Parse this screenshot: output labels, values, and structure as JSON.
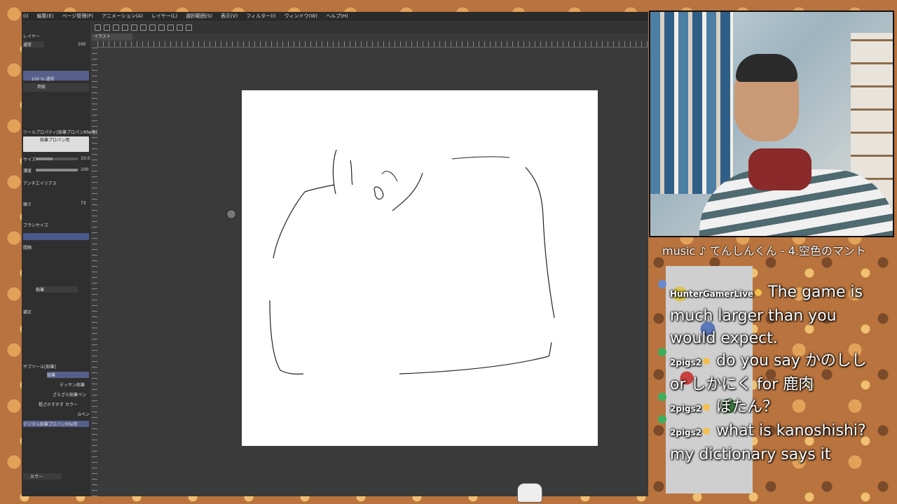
{
  "menu": [
    "(I)",
    "編集(E)",
    "ページ管理(P)",
    "アニメーション(A)",
    "レイヤー(L)",
    "選択範囲(S)",
    "表示(V)",
    "フィルター(I)",
    "ウィンドウ(W)",
    "ヘルプ(H)"
  ],
  "tab_label": "イラスト",
  "panel": {
    "layer_title": "レイヤー",
    "blend_mode": "通常",
    "opacity": "100",
    "layer1": "100 % 通常\nレイヤー 1",
    "layer2": "用紙",
    "tool_property_title": "ツールプロパティ[鉛筆プロパンRfw用]",
    "brush_name": "鉛筆プロパン用",
    "size_label": "サイズ",
    "size_value": "10.0",
    "density_label": "濃度",
    "density_value": "100",
    "antialias_label": "アンチエイリアス",
    "hardness_label": "硬さ",
    "hardness_value": "73",
    "brush_size_label": "ブラシサイズ",
    "spacing_label": "間隔",
    "pencil_label": "鉛筆",
    "stroke_label": "補正",
    "subtool_title": "サブツール[鉛筆]",
    "subtool_tab": "鉛筆",
    "brushes": [
      "デッサン鉛筆",
      "ざらざら鉛筆ペン",
      "粗ざかすかす カラー",
      "Gペン",
      "デジタル鉛筆プロパンRfw用"
    ],
    "color_label": "カラー"
  },
  "music": "music ♪ てんしんくん - 4.空色のマント",
  "chat": [
    {
      "user": "HunterGamerLive",
      "text": "The game is much larger than you would expect."
    },
    {
      "user": "2pigs2",
      "text": "do you say かのしし or しかにく for 鹿肉"
    },
    {
      "user": "2pigs2",
      "text": "ぼたん？"
    },
    {
      "user": "2pigs2",
      "text": "what is kanoshishi? my dictionary says it"
    }
  ]
}
